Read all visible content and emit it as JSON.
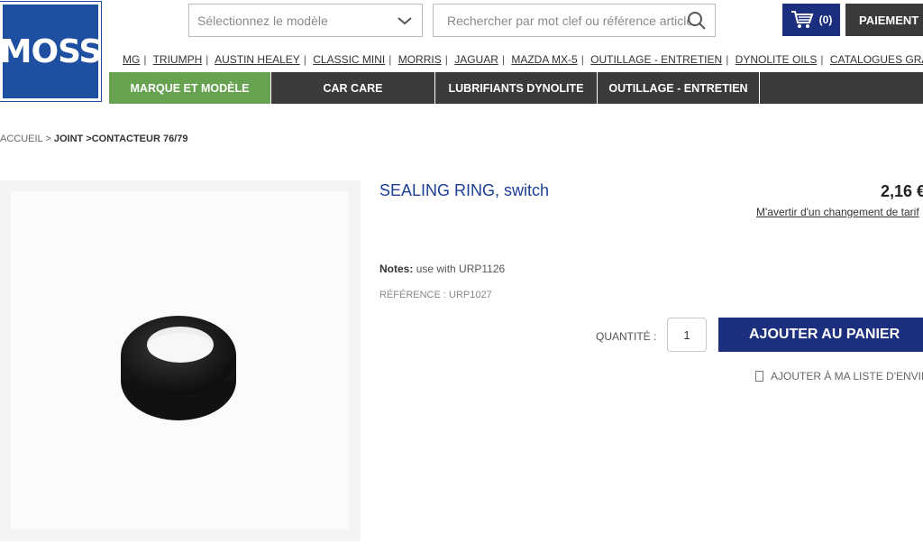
{
  "logo": {
    "text": "MOSS"
  },
  "header": {
    "model_select_placeholder": "Sélectionnez le modèle",
    "search_placeholder": "Rechercher par mot clef ou référence article",
    "cart_count": "(0)",
    "pay_label": "PAIEMENT"
  },
  "brands": [
    "MG",
    "TRIUMPH",
    "AUSTIN HEALEY",
    "CLASSIC MINI",
    "MORRIS",
    "JAGUAR",
    "MAZDA MX-5",
    "OUTILLAGE - ENTRETIEN",
    "DYNOLITE OILS",
    "CATALOGUES GRATUITS"
  ],
  "nav": {
    "items": [
      "MARQUE ET MODÈLE",
      "CAR CARE",
      "LUBRIFIANTS DYNOLITE",
      "OUTILLAGE - ENTRETIEN",
      ""
    ]
  },
  "breadcrumb": {
    "home": "ACCUEIL",
    "sep": ">",
    "current": "JOINT >CONTACTEUR 76/79"
  },
  "product": {
    "title": "SEALING RING, switch",
    "price": "2,16 €",
    "price_alert": "M'avertir d'un changement de tarif",
    "notes_label": "Notes:",
    "notes_value": "use with URP1126",
    "reference": "RÉFÉRENCE : URP1027",
    "quantity_label": "QUANTITÉ :",
    "quantity_value": "1",
    "add_to_cart": "AJOUTER AU PANIER",
    "wishlist": "AJOUTER À MA LISTE D'ENVIES"
  },
  "colors": {
    "brand_blue": "#1f4fa0",
    "navy": "#1b2f7e",
    "green": "#67a250",
    "dark_nav": "#3b3b3b"
  }
}
